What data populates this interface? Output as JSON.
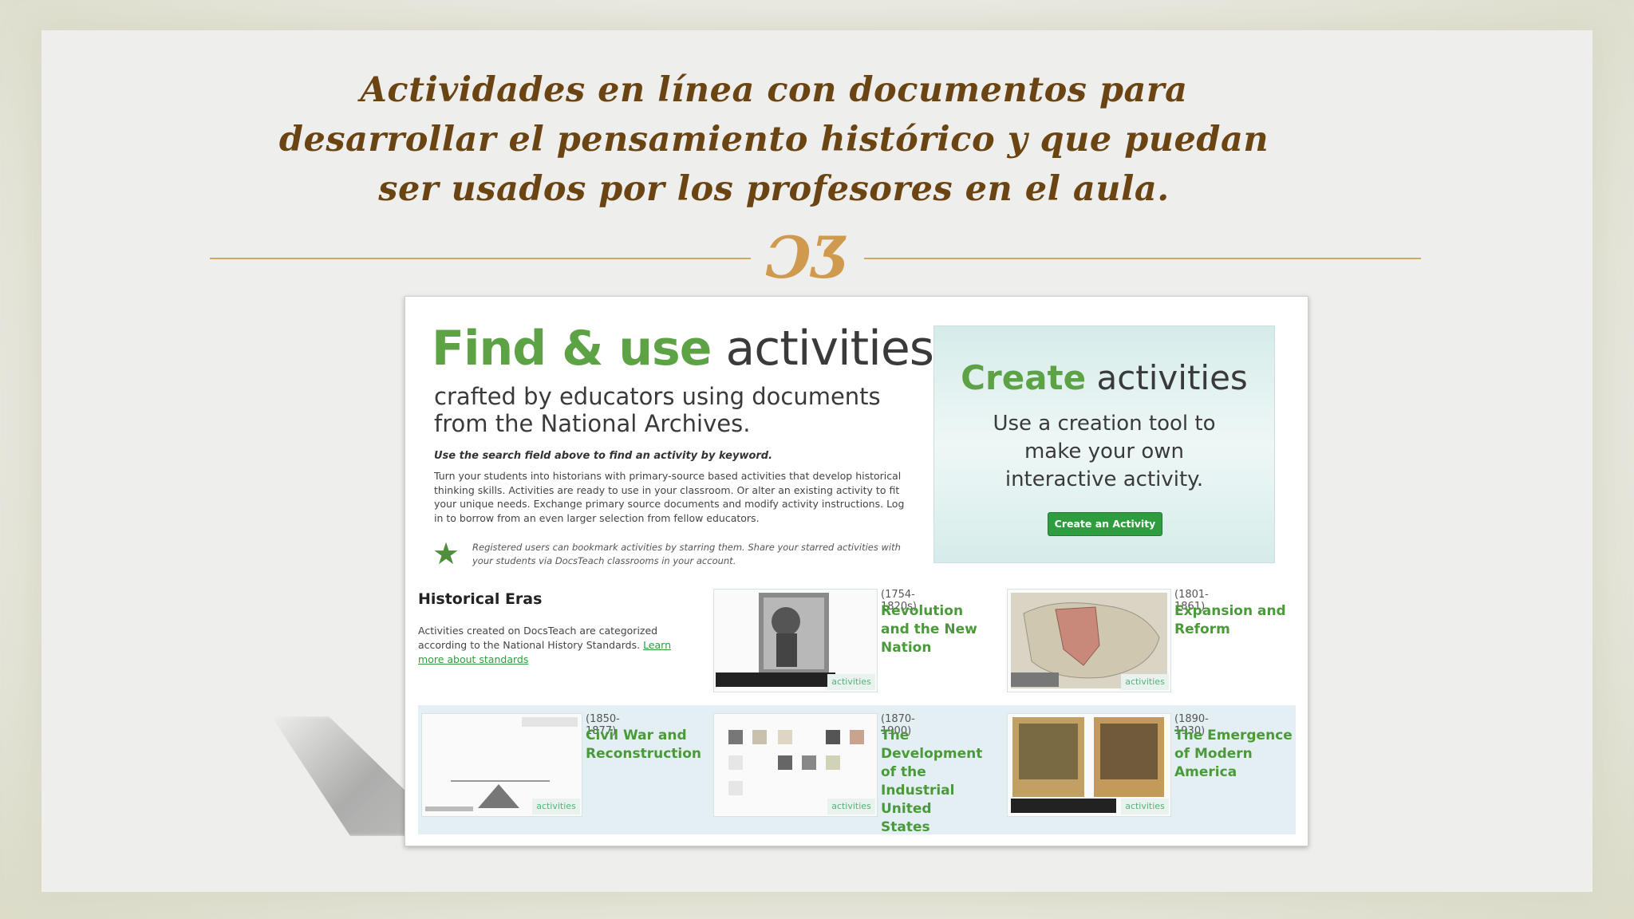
{
  "slide": {
    "title": "Actividades en línea con documentos para desarrollar el pensamiento histórico y que puedan ser usados por los profesores en el aula.",
    "ornament": "ƆƷ"
  },
  "screenshot": {
    "heading_green": "Find & use",
    "heading_dark": "activities",
    "subheading": "crafted by educators using documents from the National Archives.",
    "search_hint": "Use the search field above to find an activity by keyword.",
    "intro": "Turn your students into historians with primary-source based activities that develop historical thinking skills. Activities are ready to use in your classroom. Or alter an existing activity to fit your unique needs. Exchange primary source documents and modify activity instructions. Log in to borrow from an even larger selection from fellow educators.",
    "star_note": "Registered users can bookmark activities by starring them. Share your starred activities with your students via DocsTeach classrooms in your account.",
    "create": {
      "heading_green": "Create",
      "heading_dark": "activities",
      "description": "Use a creation tool to make your own interactive activity.",
      "button": "Create an Activity"
    },
    "eras": {
      "heading": "Historical Eras",
      "text": "Activities created on DocsTeach are categorized according to the National History Standards.",
      "learn_link": "Learn more about standards",
      "items": [
        {
          "years": "(1754-1820s)",
          "title": "Revolution and the New Nation",
          "tag": "activities"
        },
        {
          "years": "(1801-1861)",
          "title": "Expansion and Reform",
          "tag": "activities"
        },
        {
          "years": "(1850-1877)",
          "title": "Civil War and Reconstruction",
          "tag": "activities"
        },
        {
          "years": "(1870-1900)",
          "title": "The Development of the Industrial United States",
          "tag": "activities"
        },
        {
          "years": "(1890-1930)",
          "title": "The Emergence of Modern America",
          "tag": "activities"
        }
      ]
    }
  },
  "colors": {
    "title_brown": "#6b4414",
    "ornament_gold": "#cf9a4e",
    "docsteach_green": "#5da244",
    "button_green": "#2f9d3f"
  }
}
